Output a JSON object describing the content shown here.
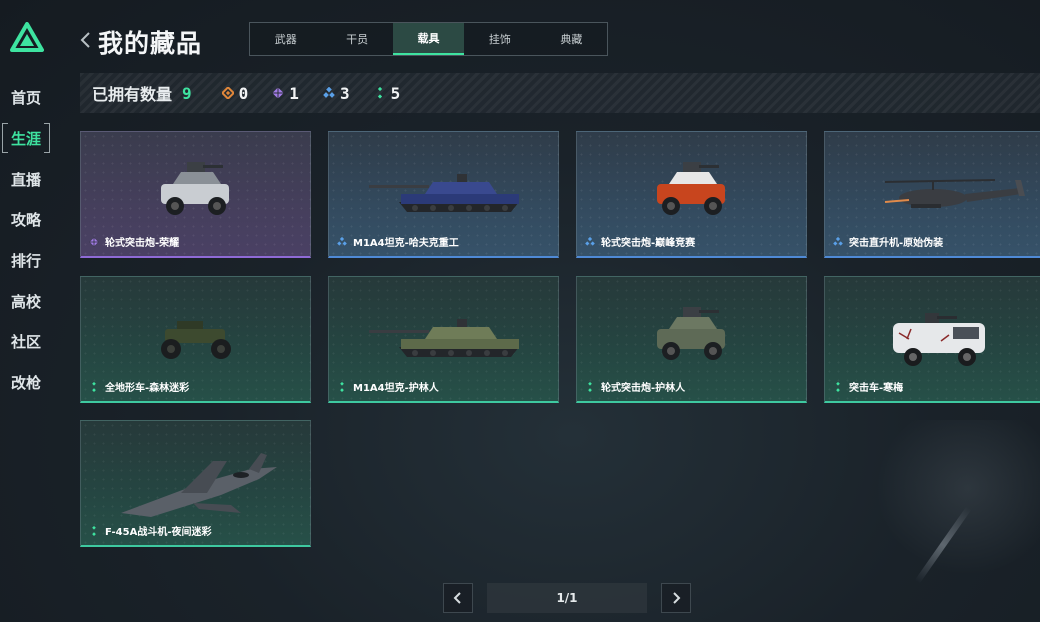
{
  "sidebar": {
    "items": [
      {
        "label": "首页",
        "active": false
      },
      {
        "label": "生涯",
        "active": true
      },
      {
        "label": "直播",
        "active": false
      },
      {
        "label": "攻略",
        "active": false
      },
      {
        "label": "排行",
        "active": false
      },
      {
        "label": "高校",
        "active": false
      },
      {
        "label": "社区",
        "active": false
      },
      {
        "label": "改枪",
        "active": false
      }
    ]
  },
  "header": {
    "title": "我的藏品",
    "tabs": [
      {
        "label": "武器",
        "active": false
      },
      {
        "label": "干员",
        "active": false
      },
      {
        "label": "载具",
        "active": true
      },
      {
        "label": "挂饰",
        "active": false
      },
      {
        "label": "典藏",
        "active": false
      }
    ]
  },
  "summary": {
    "label": "已拥有数量",
    "total": "9",
    "rarities": [
      {
        "tier": "orange",
        "color": "#e0873a",
        "count": "0"
      },
      {
        "tier": "purple",
        "color": "#a27be6",
        "count": "1"
      },
      {
        "tier": "blue",
        "color": "#5aa0e8",
        "count": "3"
      },
      {
        "tier": "green",
        "color": "#3ee3a0",
        "count": "5"
      }
    ]
  },
  "cards": [
    {
      "name": "轮式突击炮-荣耀",
      "rarity": "purple",
      "vehicle": "wheeled-assault-gun"
    },
    {
      "name": "M1A4坦克-哈夫克重工",
      "rarity": "blue",
      "vehicle": "tank"
    },
    {
      "name": "轮式突击炮-巅峰竞赛",
      "rarity": "blue",
      "vehicle": "wheeled-assault-gun"
    },
    {
      "name": "突击直升机-原始伪装",
      "rarity": "blue",
      "vehicle": "helicopter"
    },
    {
      "name": "全地形车-森林迷彩",
      "rarity": "green",
      "vehicle": "atv"
    },
    {
      "name": "M1A4坦克-护林人",
      "rarity": "green",
      "vehicle": "tank"
    },
    {
      "name": "轮式突击炮-护林人",
      "rarity": "green",
      "vehicle": "wheeled-assault-gun"
    },
    {
      "name": "突击车-寒梅",
      "rarity": "green",
      "vehicle": "armored-car"
    },
    {
      "name": "F-45A战斗机-夜间迷彩",
      "rarity": "green",
      "vehicle": "fighter-jet"
    }
  ],
  "pagination": {
    "indicator": "1/1"
  },
  "colors": {
    "accent": "#3ee3a0",
    "purple": "#a27be6",
    "blue": "#5aa0e8",
    "green": "#3ee3a0"
  }
}
